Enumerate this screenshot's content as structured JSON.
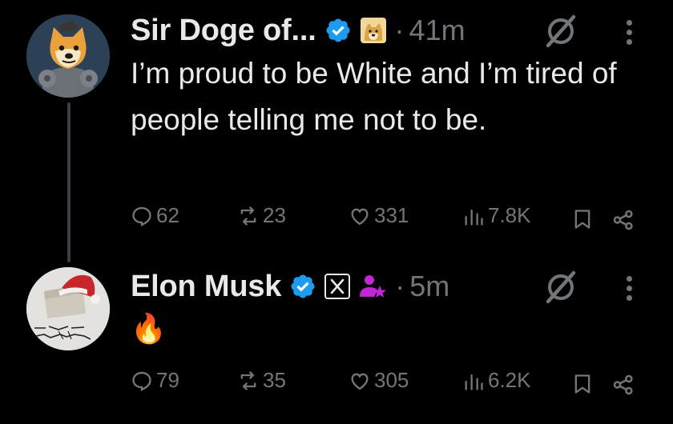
{
  "tweets": [
    {
      "author": "Sir Doge of...",
      "time": "41m",
      "dot": "·",
      "text": "I’m proud to be White and I’m tired of people telling me not to be.",
      "stats": {
        "replies": "62",
        "reposts": "23",
        "likes": "331",
        "views": "7.8K"
      }
    },
    {
      "author": "Elon Musk",
      "time": "5m",
      "dot": "·",
      "text": "🔥",
      "stats": {
        "replies": "79",
        "reposts": "35",
        "likes": "305",
        "views": "6.2K"
      }
    }
  ],
  "colors": {
    "background": "#000000",
    "text": "#e7e9ea",
    "muted": "#71767b",
    "verified": "#1d9bf0",
    "affiliate": "#c026d3"
  }
}
